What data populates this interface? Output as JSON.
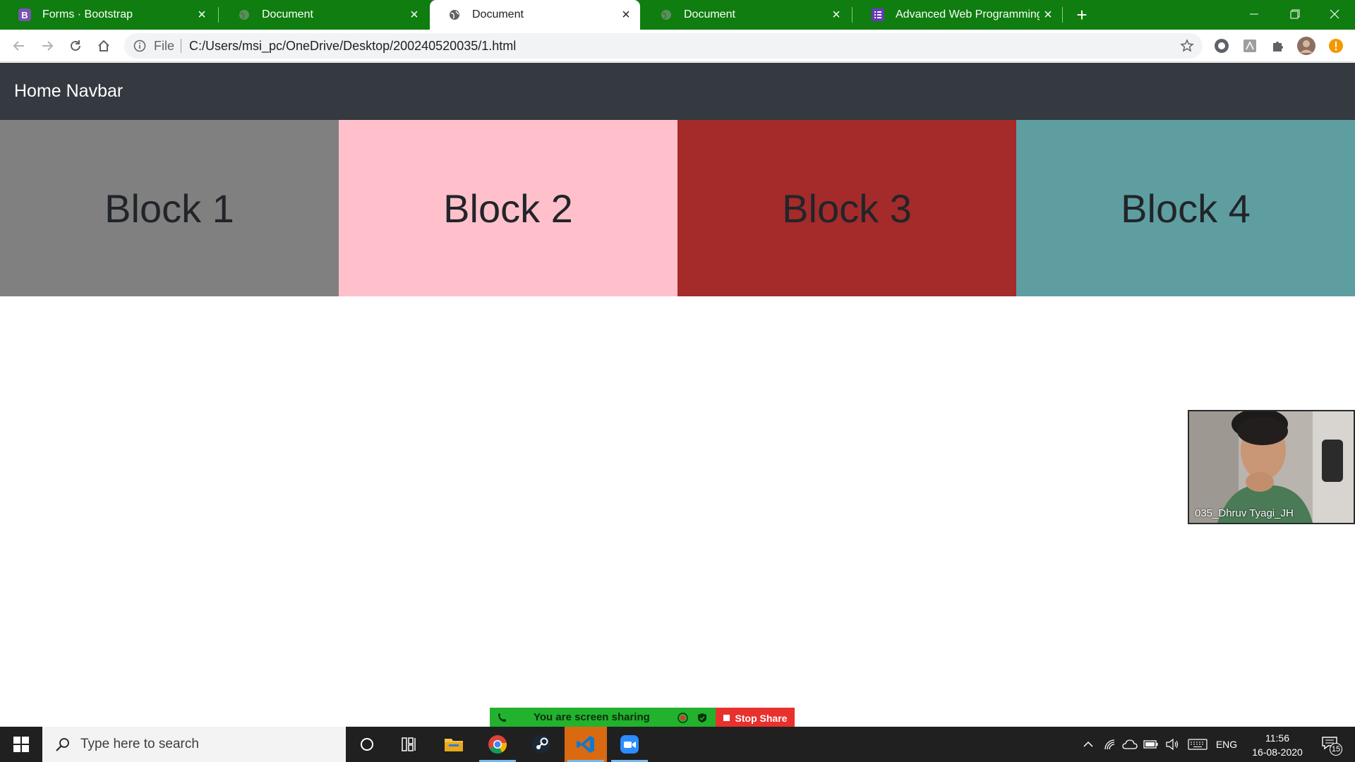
{
  "browser": {
    "tabs": [
      {
        "title": "Forms · Bootstrap",
        "favicon": "bootstrap-icon",
        "active": false
      },
      {
        "title": "Document",
        "favicon": "globe-icon",
        "active": false
      },
      {
        "title": "Document",
        "favicon": "globe-icon",
        "active": true
      },
      {
        "title": "Document",
        "favicon": "globe-icon",
        "active": false
      },
      {
        "title": "Advanced Web Programming En",
        "favicon": "form-list-icon",
        "active": false
      }
    ],
    "address": {
      "scheme_label": "File",
      "url": "C:/Users/msi_pc/OneDrive/Desktop/200240520035/1.html"
    },
    "theme_color": "#0f7d0f"
  },
  "page": {
    "navbar": {
      "brand": "Home Navbar",
      "background": "#343a40"
    },
    "blocks": [
      {
        "label": "Block 1",
        "color": "#808080"
      },
      {
        "label": "Block 2",
        "color": "#ffc0cb"
      },
      {
        "label": "Block 3",
        "color": "#a52a2a"
      },
      {
        "label": "Block 4",
        "color": "#5f9ea0"
      }
    ]
  },
  "zoom": {
    "participant_name": "035_Dhruv Tyagi_JH",
    "share_status": "You are screen sharing",
    "stop_share_label": "Stop Share"
  },
  "taskbar": {
    "search_placeholder": "Type here to search",
    "language": "ENG",
    "time": "11:56",
    "date": "16-08-2020",
    "notification_count": "15"
  }
}
